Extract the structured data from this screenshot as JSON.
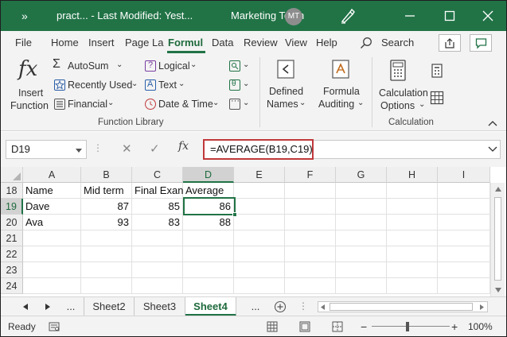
{
  "titlebar": {
    "ribbon_options_glyph": "»",
    "title": "pract...  -  Last Modified: Yest...",
    "workspace": "Marketing Team",
    "avatar_initials": "MT"
  },
  "menu": {
    "tabs": [
      {
        "label": "File"
      },
      {
        "label": "Home"
      },
      {
        "label": "Insert"
      },
      {
        "label": "Page La"
      },
      {
        "label": "Formul"
      },
      {
        "label": "Data"
      },
      {
        "label": "Review"
      },
      {
        "label": "View"
      },
      {
        "label": "Help"
      }
    ],
    "active_tab_index": 4,
    "search_label": "Search"
  },
  "ribbon": {
    "insert_function": {
      "symbol": "fx",
      "line1": "Insert",
      "line2": "Function"
    },
    "autosum": {
      "label": "AutoSum",
      "symbol": "Σ"
    },
    "recently_used": {
      "label": "Recently Used"
    },
    "financial": {
      "label": "Financial"
    },
    "logical": {
      "label": "Logical"
    },
    "text": {
      "label": "Text"
    },
    "date_time": {
      "label": "Date & Time"
    },
    "defined_names": {
      "line1": "Defined",
      "line2": "Names"
    },
    "formula_auditing": {
      "line1": "Formula",
      "line2": "Auditing"
    },
    "calculation_options": {
      "line1": "Calculation",
      "line2": "Options"
    },
    "groups": {
      "function_library": "Function Library",
      "calculation": "Calculation"
    }
  },
  "formula_bar": {
    "name_box": "D19",
    "cancel_glyph": "✕",
    "enter_glyph": "✓",
    "fx_glyph": "fx",
    "formula": "=AVERAGE(B19,C19)"
  },
  "grid": {
    "columns": [
      "A",
      "B",
      "C",
      "D",
      "E",
      "F",
      "G",
      "H",
      "I"
    ],
    "selected_column": "D",
    "rows": [
      {
        "num": "18",
        "cells": [
          "Name",
          "Mid term",
          "Final Exan",
          "Average",
          "",
          "",
          "",
          "",
          ""
        ]
      },
      {
        "num": "19",
        "cells": [
          "Dave",
          "87",
          "85",
          "86",
          "",
          "",
          "",
          "",
          ""
        ]
      },
      {
        "num": "20",
        "cells": [
          "Ava",
          "93",
          "83",
          "88",
          "",
          "",
          "",
          "",
          ""
        ]
      },
      {
        "num": "21",
        "cells": [
          "",
          "",
          "",
          "",
          "",
          "",
          "",
          "",
          ""
        ]
      },
      {
        "num": "22",
        "cells": [
          "",
          "",
          "",
          "",
          "",
          "",
          "",
          "",
          ""
        ]
      },
      {
        "num": "23",
        "cells": [
          "",
          "",
          "",
          "",
          "",
          "",
          "",
          "",
          ""
        ]
      },
      {
        "num": "24",
        "cells": [
          "",
          "",
          "",
          "",
          "",
          "",
          "",
          "",
          ""
        ]
      }
    ],
    "selected_row": "19",
    "active_cell": "D19"
  },
  "sheets": {
    "ellipsis": "...",
    "tabs": [
      {
        "label": "Sheet2"
      },
      {
        "label": "Sheet3"
      },
      {
        "label": "Sheet4"
      }
    ],
    "active_sheet": "Sheet4",
    "more": "..."
  },
  "statusbar": {
    "ready": "Ready",
    "zoom_minus": "−",
    "zoom_plus": "+",
    "zoom": "100%"
  },
  "colors": {
    "accent": "#217346",
    "highlight_border": "#c0393b"
  }
}
